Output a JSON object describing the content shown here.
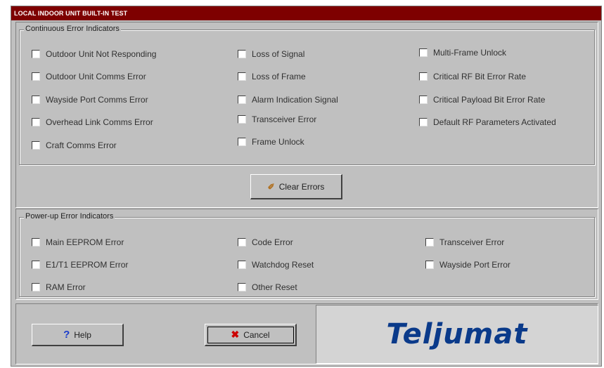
{
  "window": {
    "title": "LOCAL INDOOR UNIT BUILT-IN TEST"
  },
  "continuous": {
    "legend": "Continuous Error Indicators",
    "col1": [
      "Outdoor Unit Not Responding",
      "Outdoor Unit Comms Error",
      "Wayside Port Comms Error",
      "Overhead Link Comms Error",
      "Craft Comms Error"
    ],
    "col2": [
      "Loss of Signal",
      "Loss of Frame",
      "Alarm Indication Signal",
      "Transceiver Error",
      "Frame Unlock"
    ],
    "col3": [
      "Multi-Frame Unlock",
      "Critical RF Bit Error Rate",
      "Critical Payload Bit Error Rate",
      "Default RF Parameters Activated"
    ],
    "clear_button": "Clear Errors"
  },
  "powerup": {
    "legend": "Power-up Error Indicators",
    "col1": [
      "Main EEPROM Error",
      "E1/T1 EEPROM Error",
      "RAM Error"
    ],
    "col2": [
      "Code Error",
      "Watchdog Reset",
      "Other Reset"
    ],
    "col3": [
      "Transceiver Error",
      "Wayside Port Error"
    ]
  },
  "footer": {
    "help_button": "Help",
    "cancel_button": "Cancel",
    "logo_text": "Teljumat"
  },
  "colors": {
    "titlebar": "#7e0000",
    "logo": "#0a3a8a",
    "help_icon": "#1a3ccc",
    "cancel_icon": "#cc0000"
  },
  "icons": {
    "help": "question-mark-icon",
    "cancel": "x-icon",
    "clear": "eraser-icon"
  }
}
